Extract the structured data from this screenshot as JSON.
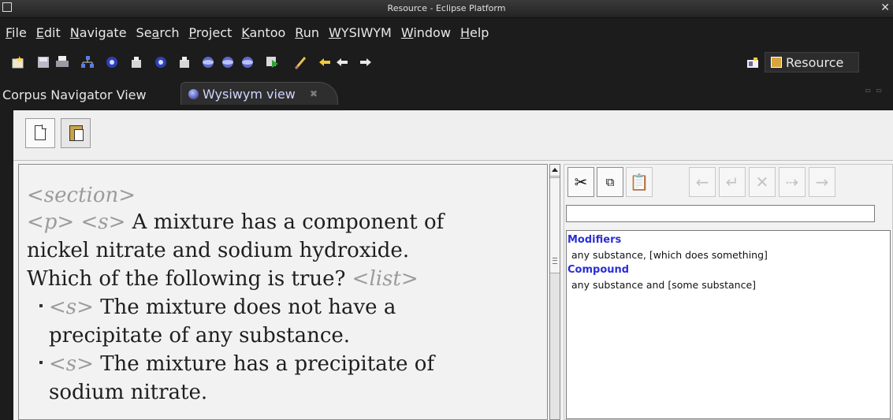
{
  "window": {
    "title": "Resource - Eclipse Platform"
  },
  "menu": [
    {
      "pre": "",
      "u": "F",
      "post": "ile"
    },
    {
      "pre": "",
      "u": "E",
      "post": "dit"
    },
    {
      "pre": "",
      "u": "N",
      "post": "avigate"
    },
    {
      "pre": "Se",
      "u": "a",
      "post": "rch"
    },
    {
      "pre": "",
      "u": "P",
      "post": "roject"
    },
    {
      "pre": "",
      "u": "K",
      "post": "antoo"
    },
    {
      "pre": "",
      "u": "R",
      "post": "un"
    },
    {
      "pre": "",
      "u": "W",
      "post": "YSIWYM"
    },
    {
      "pre": "",
      "u": "W",
      "post": "indow"
    },
    {
      "pre": "",
      "u": "H",
      "post": "elp"
    }
  ],
  "perspective": {
    "label": "Resource"
  },
  "tabs": {
    "corpus": "Corpus Navigator View",
    "wysiwym": "Wysiwym view"
  },
  "editor": {
    "l1_tag": "<section>",
    "l2_tag1": "<p>",
    "l2_tag2": "<s>",
    "l2_text": "A mixture has a component of",
    "l3_text": "nickel nitrate and sodium hydroxide.",
    "l4_text": "Which of the following is true?",
    "l4_tag": "<list>",
    "l5_tag": "<s>",
    "l5_text": "The mixture does not have a",
    "l6_text": "precipitate of any substance.",
    "l7_tag": "<s>",
    "l7_text": "The mixture has a precipitate of",
    "l8_text": "sodium nitrate."
  },
  "right_panel": {
    "filter_value": "",
    "buttons": [
      "cut-icon",
      "copy-icon",
      "paste-icon",
      "arrow-left-icon",
      "insert-before-icon",
      "delete-icon",
      "insert-after-icon",
      "arrow-right-icon"
    ],
    "groups": [
      {
        "title": "Modifiers",
        "item": "any substance, [which does something]"
      },
      {
        "title": "Compound",
        "item": "any substance and [some substance]"
      }
    ]
  }
}
